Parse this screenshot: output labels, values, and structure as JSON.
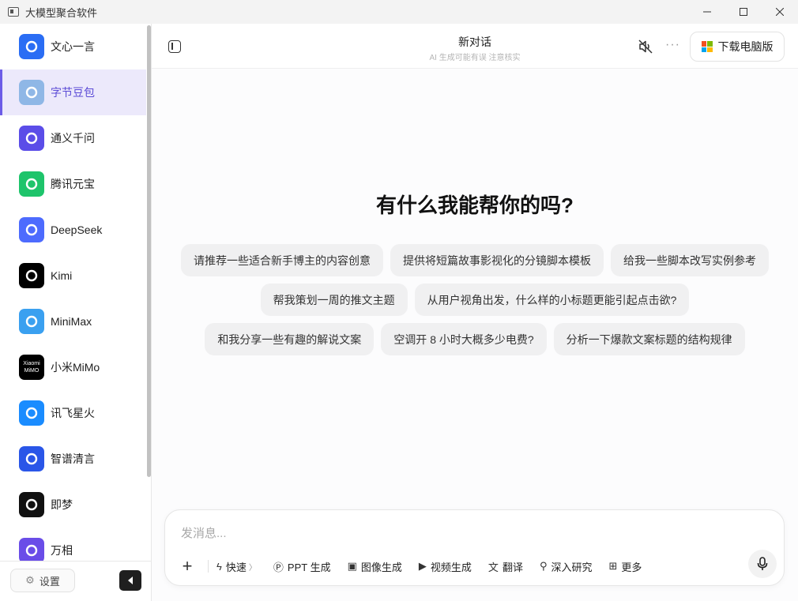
{
  "window": {
    "title": "大模型聚合软件",
    "controls": {
      "minimize": "—",
      "maximize": "☐",
      "close": "✕"
    }
  },
  "sidebar": {
    "items": [
      {
        "label": "文心一言",
        "icon": "wenxin-icon",
        "color": "#2a6df4"
      },
      {
        "label": "字节豆包",
        "icon": "doubao-icon",
        "color": "#8fb7e6"
      },
      {
        "label": "通义千问",
        "icon": "tongyi-icon",
        "color": "#5b4de8"
      },
      {
        "label": "腾讯元宝",
        "icon": "yuanbao-icon",
        "color": "#1ec46b"
      },
      {
        "label": "DeepSeek",
        "icon": "deepseek-icon",
        "color": "#4d6bfe"
      },
      {
        "label": "Kimi",
        "icon": "kimi-icon",
        "color": "#000000"
      },
      {
        "label": "MiniMax",
        "icon": "minimax-icon",
        "color": "#3aa0f0"
      },
      {
        "label": "小米MiMo",
        "icon": "mimo-icon",
        "color": "#000000",
        "logo_text": "Xiaomi MiMO"
      },
      {
        "label": "讯飞星火",
        "icon": "xinghuo-icon",
        "color": "#1a8cff"
      },
      {
        "label": "智谱清言",
        "icon": "zhipu-icon",
        "color": "#2a56e8"
      },
      {
        "label": "即梦",
        "icon": "jimeng-icon",
        "color": "#111111"
      },
      {
        "label": "万相",
        "icon": "wanxiang-icon",
        "color": "#6a4de8"
      }
    ],
    "active_index": 1,
    "settings_label": "设置"
  },
  "header": {
    "title": "新对话",
    "subtitle": "AI 生成可能有误 注意核实",
    "download_label": "下载电脑版"
  },
  "welcome": "有什么我能帮你的吗?",
  "suggestions": [
    [
      "请推荐一些适合新手博主的内容创意",
      "提供将短篇故事影视化的分镜脚本模板",
      "给我一些脚本改写实例参考"
    ],
    [
      "帮我策划一周的推文主题",
      "从用户视角出发，什么样的小标题更能引起点击欲?"
    ],
    [
      "和我分享一些有趣的解说文案",
      "空调开 8 小时大概多少电费?",
      "分析一下爆款文案标题的结构规律"
    ]
  ],
  "input": {
    "placeholder": "发消息...",
    "tools": [
      {
        "label": "快速",
        "icon": "lightning-icon",
        "glyph": "ϟ",
        "caret": "〉"
      },
      {
        "label": "PPT 生成",
        "icon": "ppt-icon",
        "glyph": "Ⓟ"
      },
      {
        "label": "图像生成",
        "icon": "image-icon",
        "glyph": "▣"
      },
      {
        "label": "视频生成",
        "icon": "video-icon",
        "glyph": "▶"
      },
      {
        "label": "翻译",
        "icon": "translate-icon",
        "glyph": "文"
      },
      {
        "label": "深入研究",
        "icon": "telescope-icon",
        "glyph": "⚲"
      },
      {
        "label": "更多",
        "icon": "grid-icon",
        "glyph": "⊞"
      }
    ]
  }
}
